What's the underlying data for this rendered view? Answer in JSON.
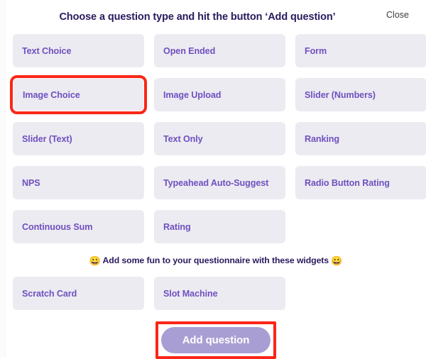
{
  "modal": {
    "title": "Choose a question type and hit the button ‘Add question’",
    "close_label": "Close"
  },
  "colors": {
    "card_bg": "#ebebf1",
    "card_text": "#7050c0",
    "title_text": "#2a1a5e",
    "highlight_border": "#fa2617",
    "primary_button_bg": "#a99ed3",
    "primary_button_text": "#ffffff",
    "page_bg": "#ffffff"
  },
  "question_types": [
    {
      "label": "Text Choice",
      "highlighted": false
    },
    {
      "label": "Open Ended",
      "highlighted": false
    },
    {
      "label": "Form",
      "highlighted": false
    },
    {
      "label": "Image Choice",
      "highlighted": true
    },
    {
      "label": "Image Upload",
      "highlighted": false
    },
    {
      "label": "Slider (Numbers)",
      "highlighted": false
    },
    {
      "label": "Slider (Text)",
      "highlighted": false
    },
    {
      "label": "Text Only",
      "highlighted": false
    },
    {
      "label": "Ranking",
      "highlighted": false
    },
    {
      "label": "NPS",
      "highlighted": false
    },
    {
      "label": "Typeahead Auto-Suggest",
      "highlighted": false
    },
    {
      "label": "Radio Button Rating",
      "highlighted": false
    },
    {
      "label": "Continuous Sum",
      "highlighted": false
    },
    {
      "label": "Rating",
      "highlighted": false
    }
  ],
  "widgets_section": {
    "note_emoji_left": "😀",
    "note_text": "Add some fun to your questionnaire with these widgets",
    "note_emoji_right": "😀",
    "items": [
      {
        "label": "Scratch Card",
        "highlighted": false
      },
      {
        "label": "Slot Machine",
        "highlighted": false
      }
    ]
  },
  "footer": {
    "add_question_label": "Add question",
    "add_question_highlighted": true
  }
}
